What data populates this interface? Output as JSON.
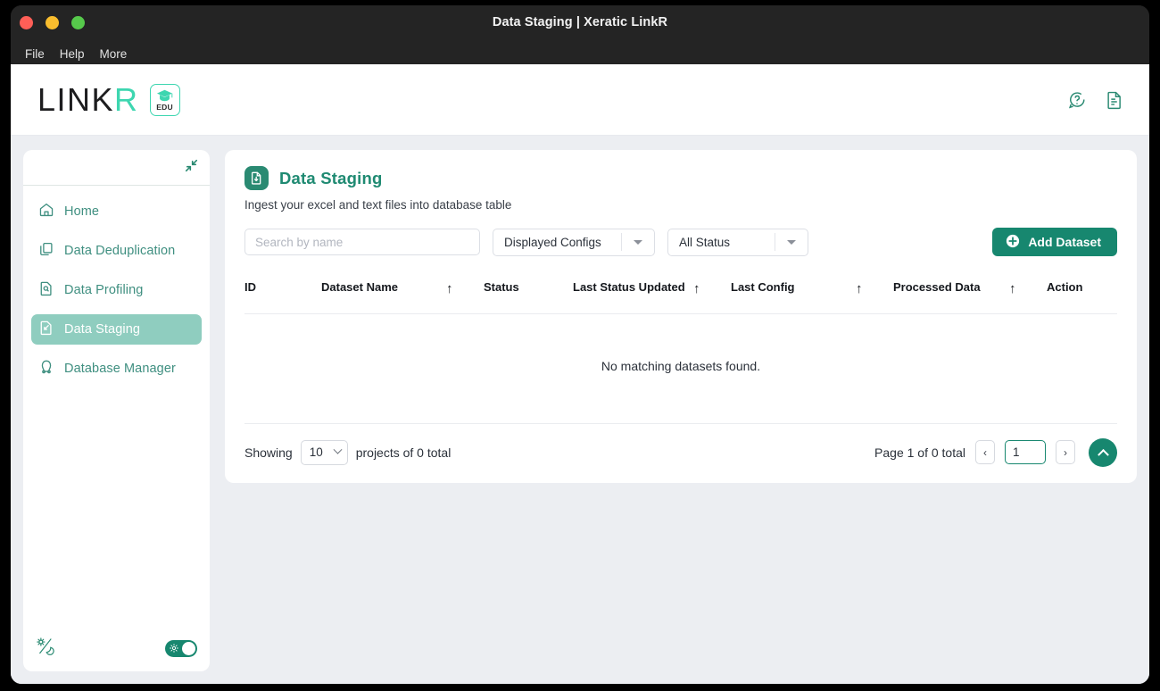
{
  "window": {
    "title": "Data Staging | Xeratic LinkR",
    "menu": [
      "File",
      "Help",
      "More"
    ]
  },
  "header": {
    "logo_main": "LINK",
    "logo_accent": "R",
    "edu_label": "EDU",
    "icons": [
      "help-chat-icon",
      "report-document-icon"
    ]
  },
  "sidebar": {
    "collapse_icon": "collapse-arrows-icon",
    "items": [
      {
        "label": "Home",
        "icon": "home-icon",
        "active": false
      },
      {
        "label": "Data Deduplication",
        "icon": "copy-icon",
        "active": false
      },
      {
        "label": "Data Profiling",
        "icon": "profile-search-icon",
        "active": false
      },
      {
        "label": "Data Staging",
        "icon": "file-arrow-icon",
        "active": true
      },
      {
        "label": "Database Manager",
        "icon": "database-icon",
        "active": false
      }
    ],
    "theme_icon": "sun-moon-icon",
    "theme_toggle_on": true
  },
  "page": {
    "icon": "file-download-icon",
    "title": "Data Staging",
    "subtitle": "Ingest your excel and text files into database table"
  },
  "filters": {
    "search_placeholder": "Search by name",
    "search_value": "",
    "configs_label": "Displayed Configs",
    "status_label": "All Status",
    "add_button": "Add Dataset",
    "add_icon": "plus-circle-icon"
  },
  "table": {
    "columns": [
      {
        "label": "ID",
        "sortable": false
      },
      {
        "label": "Dataset Name",
        "sortable": true
      },
      {
        "label": "Status",
        "sortable": false
      },
      {
        "label": "Last Status Updated",
        "sortable": true
      },
      {
        "label": "Last Config",
        "sortable": true
      },
      {
        "label": "Processed Data",
        "sortable": true
      },
      {
        "label": "Action",
        "sortable": false
      }
    ],
    "sort_arrow": "↑",
    "rows": [],
    "empty_message": "No matching datasets found."
  },
  "footer": {
    "showing_prefix": "Showing",
    "per_page": "10",
    "showing_suffix": "projects of 0 total",
    "page_text": "Page 1 of 0 total",
    "prev": "‹",
    "next": "›",
    "page_value": "1",
    "scroll_top_icon": "chevron-up-icon"
  },
  "colors": {
    "accent": "#17876f",
    "accent_light": "#8fcdbf",
    "logo_accent": "#3dd6b0",
    "title_bar": "#242424",
    "app_bg": "#eceef2"
  }
}
